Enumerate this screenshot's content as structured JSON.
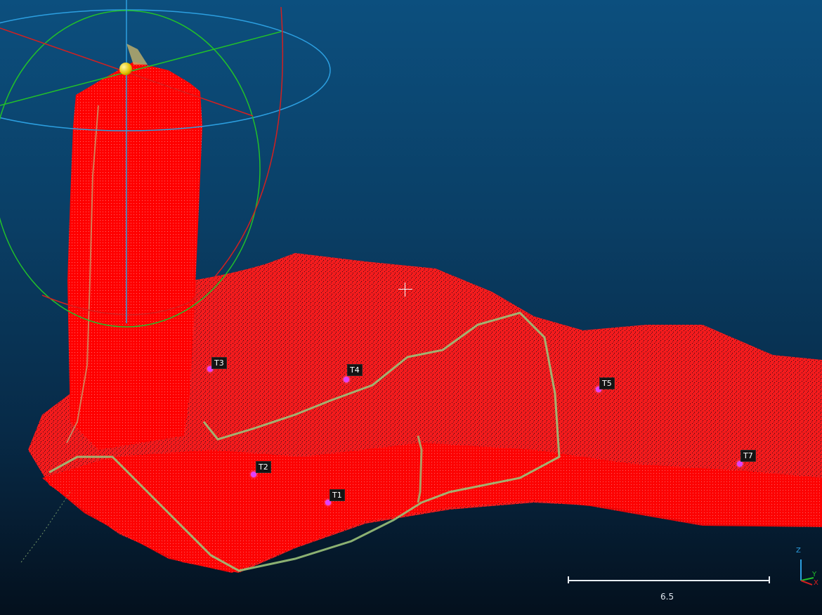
{
  "viewer": {
    "background_top": "#0c4f7e",
    "background_bottom": "#04101d",
    "point_color": "#ff0000",
    "trace_color": "#9bc27a",
    "marker_color": "#e040fb"
  },
  "targets": [
    {
      "label": "T1"
    },
    {
      "label": "T2"
    },
    {
      "label": "T3"
    },
    {
      "label": "T4"
    },
    {
      "label": "T5"
    },
    {
      "label": "T7"
    }
  ],
  "scale": {
    "label": "6.5"
  },
  "axes": {
    "x": "X",
    "y": "Y",
    "z": "Z"
  },
  "trackball": {
    "colors": {
      "x": "#d32020",
      "y": "#22c02a",
      "z": "#2c9fe0"
    }
  }
}
